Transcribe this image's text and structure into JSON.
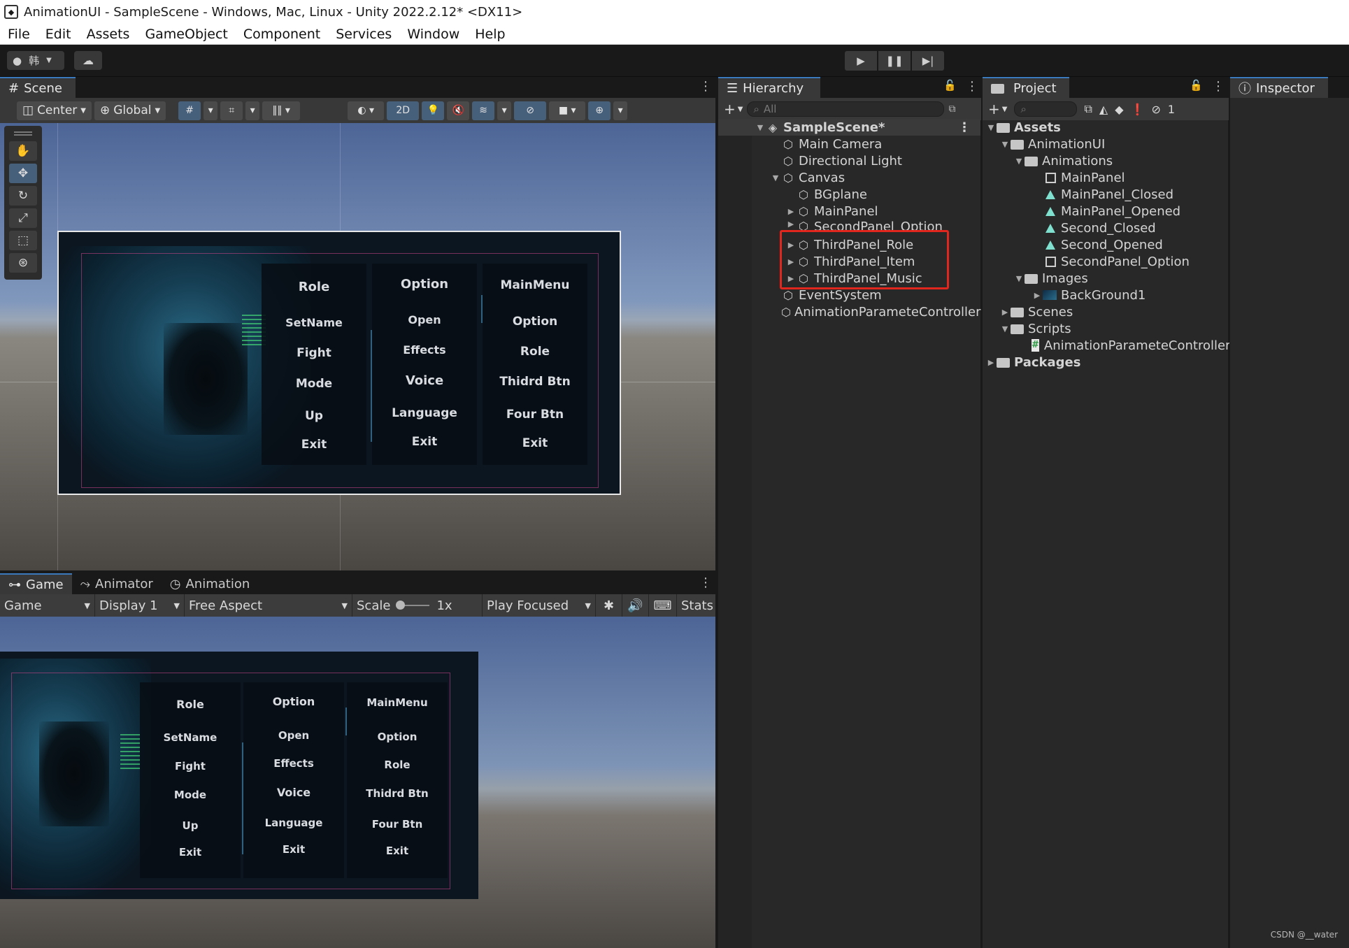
{
  "window": {
    "title": "AnimationUI - SampleScene - Windows, Mac, Linux - Unity 2022.2.12* <DX11>"
  },
  "menu": [
    "File",
    "Edit",
    "Assets",
    "GameObject",
    "Component",
    "Services",
    "Window",
    "Help"
  ],
  "toolbar": {
    "account_label": "韩"
  },
  "scene": {
    "tab": "Scene",
    "pivot": "Center",
    "space": "Global",
    "mode_2d": "2D"
  },
  "ui_canvas": {
    "columns": [
      {
        "header": "Role",
        "items": [
          "SetName",
          "Fight",
          "Mode",
          "Up",
          "Exit"
        ]
      },
      {
        "header": "Option",
        "items": [
          "Open",
          "Effects",
          "Voice",
          "Language",
          "Exit"
        ]
      },
      {
        "header": "MainMenu",
        "items": [
          "Option",
          "Role",
          "Thidrd Btn",
          "Four Btn",
          "Exit"
        ]
      }
    ]
  },
  "game": {
    "tabs": [
      "Game",
      "Animator",
      "Animation"
    ],
    "mode": "Game",
    "display": "Display 1",
    "aspect": "Free Aspect",
    "scale_label": "Scale",
    "scale_value": "1x",
    "play_mode": "Play Focused",
    "stats": "Stats"
  },
  "hierarchy": {
    "tab": "Hierarchy",
    "search_placeholder": "All",
    "items": [
      {
        "label": "SampleScene*"
      },
      {
        "label": "Main Camera"
      },
      {
        "label": "Directional Light"
      },
      {
        "label": "Canvas"
      },
      {
        "label": "BGplane"
      },
      {
        "label": "MainPanel"
      },
      {
        "label": "SecondPanel_Option"
      },
      {
        "label": "ThirdPanel_Role"
      },
      {
        "label": "ThirdPanel_Item"
      },
      {
        "label": "ThirdPanel_Music"
      },
      {
        "label": "EventSystem"
      },
      {
        "label": "AnimationParameteController"
      }
    ]
  },
  "project": {
    "tab": "Project",
    "hidden_count": "1",
    "items": [
      {
        "label": "Assets"
      },
      {
        "label": "AnimationUI"
      },
      {
        "label": "Animations"
      },
      {
        "label": "MainPanel"
      },
      {
        "label": "MainPanel_Closed"
      },
      {
        "label": "MainPanel_Opened"
      },
      {
        "label": "Second_Closed"
      },
      {
        "label": "Second_Opened"
      },
      {
        "label": "SecondPanel_Option"
      },
      {
        "label": "Images"
      },
      {
        "label": "BackGround1"
      },
      {
        "label": "Scenes"
      },
      {
        "label": "Scripts"
      },
      {
        "label": "AnimationParameteController"
      },
      {
        "label": "Packages"
      }
    ]
  },
  "inspector": {
    "tab": "Inspector"
  },
  "watermark": "CSDN @__water"
}
